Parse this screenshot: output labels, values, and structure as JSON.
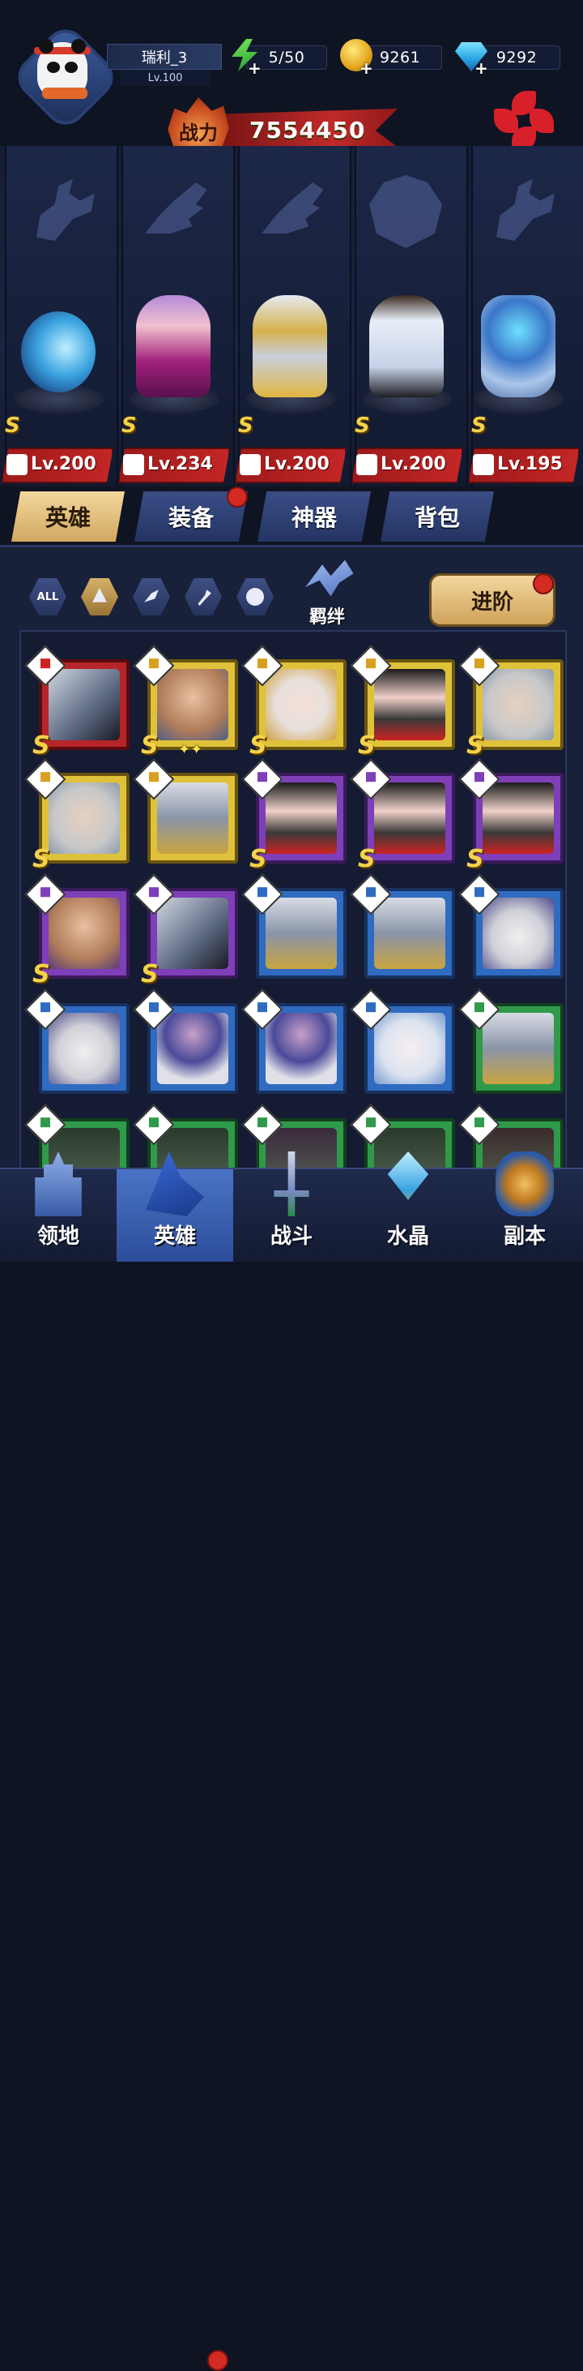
{
  "player": {
    "name": "瑞利_3",
    "level": "Lv.100"
  },
  "resources": {
    "energy": "5/50",
    "gold": "9261",
    "gems": "9292"
  },
  "power": {
    "label": "战力",
    "value": "7554450"
  },
  "heroes": [
    {
      "level": "Lv.200",
      "grade": "S",
      "class_icon": "wrench-icon"
    },
    {
      "level": "Lv.234",
      "grade": "S",
      "class_icon": "wing-icon"
    },
    {
      "level": "Lv.200",
      "grade": "S",
      "class_icon": "wing-icon"
    },
    {
      "level": "Lv.200",
      "grade": "S",
      "class_icon": "beast-icon"
    },
    {
      "level": "Lv.195",
      "grade": "S",
      "class_icon": "wrench-icon"
    }
  ],
  "tabs": {
    "hero": "英雄",
    "equipment": "装备",
    "artifact": "神器",
    "bag": "背包"
  },
  "filters": {
    "all": "ALL",
    "bond": "羁绊",
    "advance": "进阶"
  },
  "roster": {
    "row1": [
      "red",
      "gold",
      "gold",
      "gold",
      "gold"
    ],
    "row2": [
      "gold",
      "gold",
      "purple",
      "purple",
      "purple"
    ],
    "row3": [
      "purple",
      "purple",
      "blue",
      "blue",
      "blue"
    ],
    "row4": [
      "blue",
      "blue",
      "blue",
      "blue",
      "green"
    ],
    "row5": [
      "green",
      "green",
      "green",
      "green",
      "green"
    ]
  },
  "nav": {
    "territory": "领地",
    "hero": "英雄",
    "battle": "战斗",
    "crystal": "水晶",
    "dungeon": "副本"
  },
  "colors": {
    "accent_gold": "#e0c23a",
    "danger_red": "#c42626",
    "panel_bg": "#18203a"
  }
}
